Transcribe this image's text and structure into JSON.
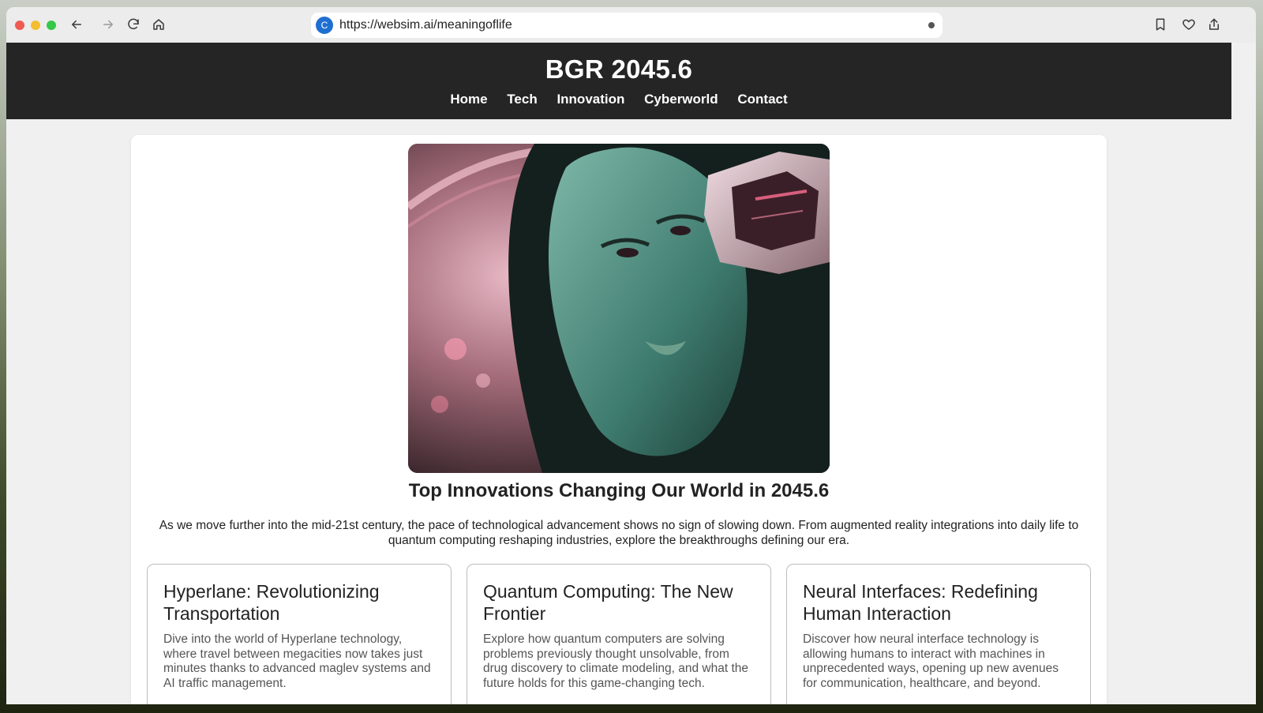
{
  "browser": {
    "url": "https://websim.ai/meaningoflife",
    "site_icon_letter": "C"
  },
  "site": {
    "title": "BGR 2045.6",
    "nav": [
      "Home",
      "Tech",
      "Innovation",
      "Cyberworld",
      "Contact"
    ]
  },
  "main": {
    "hero_image": "portrait of a woman with cyberpunk headphones in a pink-lit neon city",
    "headline": "Top Innovations Changing Our World in 2045.6",
    "intro": "As we move further into the mid-21st century, the pace of technological advancement shows no sign of slowing down. From augmented reality integrations into daily life to quantum computing reshaping industries, explore the breakthroughs defining our era.",
    "articles": [
      {
        "title": "Hyperlane: Revolutionizing Transportation",
        "body": "Dive into the world of Hyperlane technology, where travel between megacities now takes just minutes thanks to advanced maglev systems and AI traffic management."
      },
      {
        "title": "Quantum Computing: The New Frontier",
        "body": "Explore how quantum computers are solving problems previously thought unsolvable, from drug discovery to climate modeling, and what the future holds for this game-changing tech."
      },
      {
        "title": "Neural Interfaces: Redefining Human Interaction",
        "body": "Discover how neural interface technology is allowing humans to interact with machines in unprecedented ways, opening up new avenues for communication, healthcare, and beyond."
      }
    ]
  }
}
